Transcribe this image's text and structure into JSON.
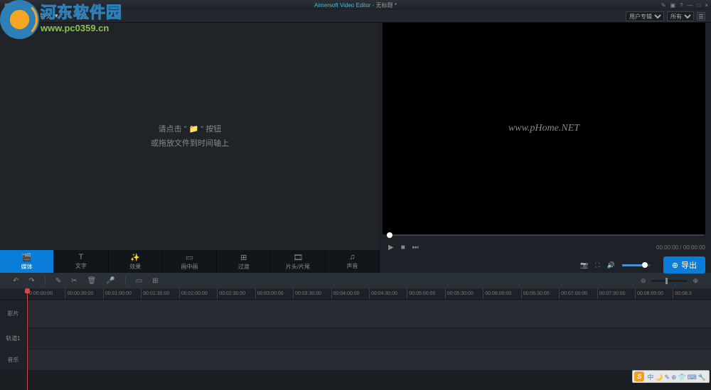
{
  "titlebar": {
    "app_name": "Aimersoft Video Editor",
    "doc_name": "- 无标题 *",
    "icons_left": [
      "▦",
      "⟲",
      "ℹ"
    ],
    "icons_right": [
      "✎",
      "▣",
      "?",
      "—",
      "□",
      "×"
    ]
  },
  "toolbar": {
    "import_label": "导入",
    "download_label": "下载",
    "dropdown1": "用户专辑",
    "dropdown2": "所有"
  },
  "logo": {
    "line1": "河东软件园",
    "line2": "www.pc0359.cn"
  },
  "media_hint": {
    "line1a": "请点击",
    "line1b": "按钮",
    "folder_glyph": "📁",
    "line2": "或拖放文件到时间轴上"
  },
  "tabs": [
    {
      "icon": "🎬",
      "label": "媒体",
      "name": "tab-media",
      "active": true
    },
    {
      "icon": "T",
      "label": "文字",
      "name": "tab-text",
      "active": false
    },
    {
      "icon": "✨",
      "label": "效果",
      "name": "tab-effects",
      "active": false
    },
    {
      "icon": "▭",
      "label": "画中画",
      "name": "tab-pip",
      "active": false
    },
    {
      "icon": "⊞",
      "label": "过渡",
      "name": "tab-transition",
      "active": false
    },
    {
      "icon": "🎞",
      "label": "片头/片尾",
      "name": "tab-intro",
      "active": false
    },
    {
      "icon": "♫",
      "label": "声音",
      "name": "tab-sound",
      "active": false
    }
  ],
  "preview": {
    "watermark": "www.pHome.NET",
    "time": "00:00:00 / 00:00:00",
    "play": "▶",
    "stop": "■",
    "next": "⏭",
    "cam": "📷",
    "full": "⛶",
    "vol": "🔊",
    "export_label": "导出",
    "export_icon": "⊕"
  },
  "tl_toolbar": {
    "undo": "↶",
    "redo": "↷",
    "edit": "✎",
    "cut": "✂",
    "del": "🗑",
    "mic": "🎤",
    "a": "▭",
    "b": "⊞",
    "zoom_out": "⊖",
    "zoom_in": "⊕"
  },
  "ruler_marks": [
    "0:00:00:00",
    "00:00:30:00",
    "00:01:00:00",
    "00:01:30:00",
    "00:02:00:00",
    "00:02:30:00",
    "00:03:00:00",
    "00:03:30:00",
    "00:04:00:00",
    "00:04:30:00",
    "00:05:00:00",
    "00:05:30:00",
    "00:06:00:00",
    "00:06:30:00",
    "00:07:00:00",
    "00:07:30:00",
    "00:08:00:00",
    "00:08:3"
  ],
  "tracks": [
    {
      "label": "影片",
      "name": "track-video",
      "tall": true
    },
    {
      "label": "轨道1",
      "name": "track-1",
      "tall": false
    },
    {
      "label": "音乐",
      "name": "track-music",
      "tall": false
    }
  ],
  "ime": {
    "s": "S",
    "items": [
      "中",
      "🌙",
      "✎",
      "⊕",
      "👕",
      "⌨",
      "🔧"
    ]
  }
}
